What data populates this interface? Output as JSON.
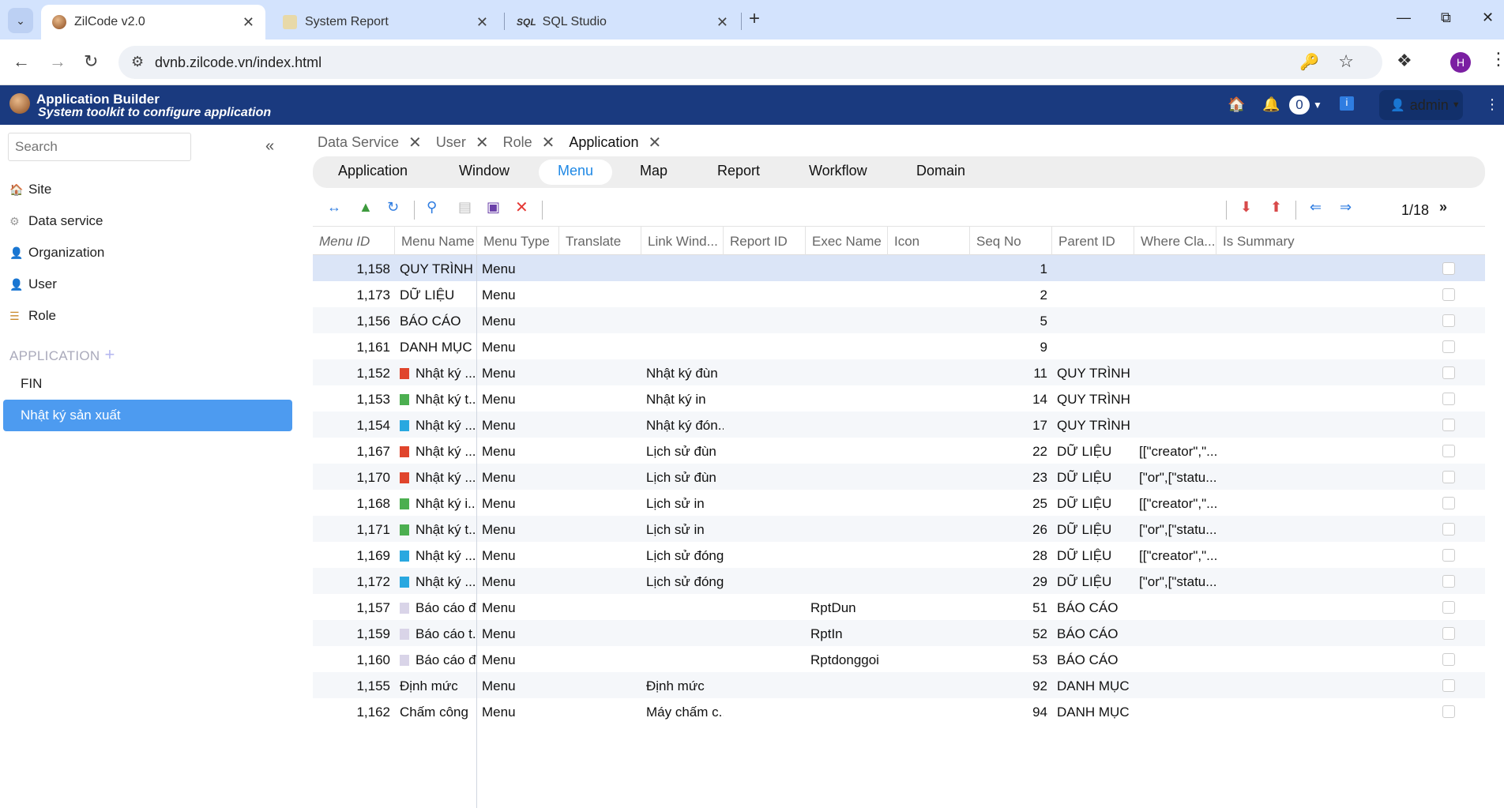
{
  "browser": {
    "tabs": [
      {
        "title": "ZilCode v2.0"
      },
      {
        "title": "System Report"
      },
      {
        "title": "SQL Studio"
      }
    ],
    "url": "dvnb.zilcode.vn/index.html",
    "profile_initial": "H"
  },
  "app": {
    "title": "Application Builder",
    "subtitle": "System toolkit to configure application",
    "notification_count": "0",
    "user": "admin"
  },
  "sidebar": {
    "search_placeholder": "Search",
    "items": [
      {
        "label": "Site",
        "icon": "home-icon"
      },
      {
        "label": "Data service",
        "icon": "gear-icon"
      },
      {
        "label": "Organization",
        "icon": "person-icon"
      },
      {
        "label": "User",
        "icon": "user-icon"
      },
      {
        "label": "Role",
        "icon": "role-icon"
      }
    ],
    "section_title": "APPLICATION",
    "app_items": [
      {
        "label": "FIN"
      },
      {
        "label": "Nhật ký sản xuất"
      }
    ]
  },
  "open_tabs": [
    {
      "label": "Data Service"
    },
    {
      "label": "User"
    },
    {
      "label": "Role"
    },
    {
      "label": "Application"
    }
  ],
  "subnav": [
    "Application",
    "Window",
    "Menu",
    "Map",
    "Report",
    "Workflow",
    "Domain"
  ],
  "pager": {
    "text": "1/18",
    "next": "»"
  },
  "columns": [
    "Menu ID",
    "Menu Name",
    "Menu Type",
    "Translate",
    "Link Wind...",
    "Report ID",
    "Exec Name",
    "Icon",
    "Seq No",
    "Parent ID",
    "Where Cla...",
    "Is Summary"
  ],
  "rows": [
    {
      "id": "1,158",
      "name": "QUY TRÌNH",
      "icon": "",
      "type": "Menu",
      "link": "",
      "exec": "",
      "seq": "1",
      "parent": "",
      "where": ""
    },
    {
      "id": "1,173",
      "name": "DỮ LIỆU",
      "icon": "",
      "type": "Menu",
      "link": "",
      "exec": "",
      "seq": "2",
      "parent": "",
      "where": ""
    },
    {
      "id": "1,156",
      "name": "BÁO CÁO",
      "icon": "",
      "type": "Menu",
      "link": "",
      "exec": "",
      "seq": "5",
      "parent": "",
      "where": ""
    },
    {
      "id": "1,161",
      "name": "DANH MỤC",
      "icon": "",
      "type": "Menu",
      "link": "",
      "exec": "",
      "seq": "9",
      "parent": "",
      "where": ""
    },
    {
      "id": "1,152",
      "name": "Nhật ký ...",
      "icon": "red",
      "type": "Menu",
      "link": "Nhật ký đùn",
      "exec": "",
      "seq": "11",
      "parent": "QUY TRÌNH",
      "where": ""
    },
    {
      "id": "1,153",
      "name": "Nhật ký t...",
      "icon": "green",
      "type": "Menu",
      "link": "Nhật ký in",
      "exec": "",
      "seq": "14",
      "parent": "QUY TRÌNH",
      "where": ""
    },
    {
      "id": "1,154",
      "name": "Nhật ký ...",
      "icon": "blue",
      "type": "Menu",
      "link": "Nhật ký đón...",
      "exec": "",
      "seq": "17",
      "parent": "QUY TRÌNH",
      "where": ""
    },
    {
      "id": "1,167",
      "name": "Nhật ký ...",
      "icon": "red",
      "type": "Menu",
      "link": "Lịch sử đùn",
      "exec": "",
      "seq": "22",
      "parent": "DỮ LIỆU",
      "where": "[[\"creator\",\"..."
    },
    {
      "id": "1,170",
      "name": "Nhật ký ...",
      "icon": "red",
      "type": "Menu",
      "link": "Lịch sử đùn",
      "exec": "",
      "seq": "23",
      "parent": "DỮ LIỆU",
      "where": "[\"or\",[\"statu..."
    },
    {
      "id": "1,168",
      "name": "Nhật ký i...",
      "icon": "green",
      "type": "Menu",
      "link": "Lịch sử in",
      "exec": "",
      "seq": "25",
      "parent": "DỮ LIỆU",
      "where": "[[\"creator\",\"..."
    },
    {
      "id": "1,171",
      "name": "Nhật ký t...",
      "icon": "green",
      "type": "Menu",
      "link": "Lịch sử in",
      "exec": "",
      "seq": "26",
      "parent": "DỮ LIỆU",
      "where": "[\"or\",[\"statu..."
    },
    {
      "id": "1,169",
      "name": "Nhật ký ...",
      "icon": "blue",
      "type": "Menu",
      "link": "Lịch sử đóng...",
      "exec": "",
      "seq": "28",
      "parent": "DỮ LIỆU",
      "where": "[[\"creator\",\"..."
    },
    {
      "id": "1,172",
      "name": "Nhật ký ...",
      "icon": "blue",
      "type": "Menu",
      "link": "Lịch sử đóng...",
      "exec": "",
      "seq": "29",
      "parent": "DỮ LIỆU",
      "where": "[\"or\",[\"statu..."
    },
    {
      "id": "1,157",
      "name": "Báo cáo đ...",
      "icon": "doc",
      "type": "Menu",
      "link": "",
      "exec": "RptDun",
      "seq": "51",
      "parent": "BÁO CÁO",
      "where": ""
    },
    {
      "id": "1,159",
      "name": "Báo cáo t...",
      "icon": "doc",
      "type": "Menu",
      "link": "",
      "exec": "RptIn",
      "seq": "52",
      "parent": "BÁO CÁO",
      "where": ""
    },
    {
      "id": "1,160",
      "name": "Báo cáo đ...",
      "icon": "doc",
      "type": "Menu",
      "link": "",
      "exec": "Rptdonggoi",
      "seq": "53",
      "parent": "BÁO CÁO",
      "where": ""
    },
    {
      "id": "1,155",
      "name": "Định mức",
      "icon": "",
      "type": "Menu",
      "link": "Định mức",
      "exec": "",
      "seq": "92",
      "parent": "DANH MỤC",
      "where": ""
    },
    {
      "id": "1,162",
      "name": "Chấm công",
      "icon": "",
      "type": "Menu",
      "link": "Máy chấm c...",
      "exec": "",
      "seq": "94",
      "parent": "DANH MỤC",
      "where": ""
    }
  ],
  "icon_colors": {
    "red": "#e0452c",
    "green": "#4caf50",
    "blue": "#29a8e0",
    "doc": "#d9d4e8"
  }
}
